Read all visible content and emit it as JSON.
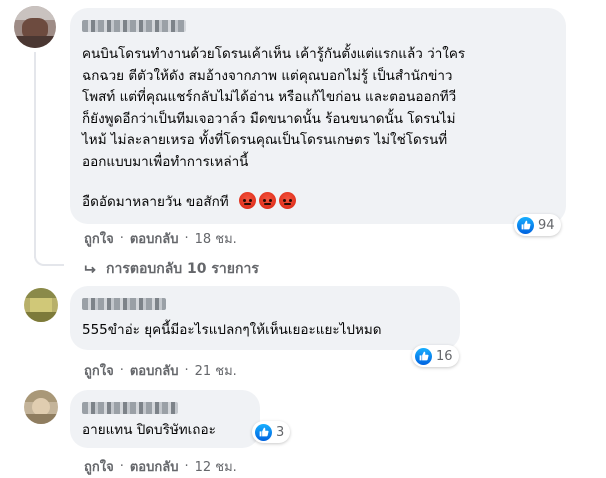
{
  "comments": [
    {
      "lines": [
        "คนบินโดรนทำงานด้วยโดรนเค้าเห็น เค้ารู้กันตั้งแต่แรกแล้ว ว่าใคร",
        "ฉกฉวย ตีตัวให้ดัง สมอ้างจากภาพ แต่คุณบอกไม่รู้ เป็นสำนักข่าว",
        "โพสท์ แต่ที่คุณแชร์กลับไม่ได้อ่าน หรือแก้ไขก่อน และตอนออกทีวี",
        "ก็ยังพูดอีกว่าเป็นทีมเจอวาล์ว มืดขนาดนั้น ร้อนขนาดนั้น โดรนไม่",
        "ไหม้ ไม่ละลายเหรอ ทั้งที่โดรนคุณเป็นโดรนเกษตร ไม่ใช่โดรนที่",
        "ออกแบบมาเพื่อทำการเหล่านี้"
      ],
      "extra_line": "อืดอัดมาหลายวัน ขอสักที",
      "emoji_icons": [
        "angry-emoji-icon",
        "angry-emoji-icon",
        "angry-emoji-icon"
      ],
      "reactions": "94",
      "like_label": "ถูกใจ",
      "reply_label": "ตอบกลับ",
      "time": "18 ชม.",
      "view_replies": "การตอบกลับ 10 รายการ"
    },
    {
      "lines": [
        "555ขำอ่ะ ยุคนี้มีอะไรแปลกๆให้เห็นเยอะแยะไปหมด"
      ],
      "reactions": "16",
      "like_label": "ถูกใจ",
      "reply_label": "ตอบกลับ",
      "time": "21 ชม."
    },
    {
      "lines": [
        "อายแทน ปิดบริษัทเถอะ"
      ],
      "reactions": "3",
      "like_label": "ถูกใจ",
      "reply_label": "ตอบกลับ",
      "time": "12 ชม."
    }
  ],
  "separator": "·",
  "colors": {
    "bubble": "#f0f2f5",
    "meta": "#65676b",
    "like_blue": "#1877f2",
    "angry": "#e0321f"
  }
}
